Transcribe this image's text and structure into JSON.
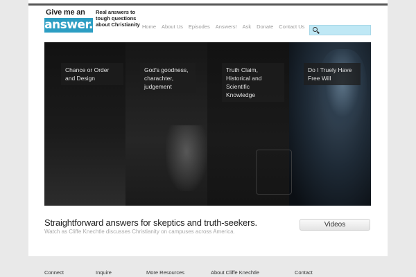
{
  "logo": {
    "top_text": "Give me an",
    "box_text": "answer.",
    "tagline": "Real answers to tough questions about Christianity"
  },
  "nav": {
    "items": [
      "Home",
      "About Us",
      "Episodes",
      "Answers!",
      "Ask",
      "Donate",
      "Contact Us"
    ]
  },
  "search": {
    "placeholder": "",
    "icon": "search-icon"
  },
  "hero": {
    "panels": [
      {
        "label": "Chance or Order and Design"
      },
      {
        "label": "God's goodness, charachter, judgement"
      },
      {
        "label": "Truth Claim, Historical and Scientific Knowledge"
      },
      {
        "label": "Do I Truely Have Free Will"
      }
    ]
  },
  "intro": {
    "headline": "Straightforward answers for skeptics and truth-seekers.",
    "subline": "Watch as Cliffe Knechtle discusses Christianity on campuses across America.",
    "button_label": "Videos"
  },
  "footer": {
    "links": [
      "Connect",
      "Inquire",
      "More Resources",
      "About Cliffe Knechtle",
      "Contact"
    ]
  },
  "colors": {
    "brand": "#2c9ec3",
    "search_bg": "#bfe8f5"
  }
}
